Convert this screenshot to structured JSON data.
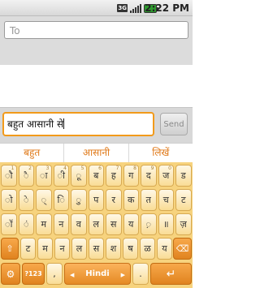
{
  "status_bar": {
    "network": "3G",
    "time": "2:22 PM"
  },
  "compose": {
    "to_placeholder": "To",
    "message_text": "बहुत आसानी से",
    "send_label": "Send"
  },
  "suggestions": [
    "बहुत",
    "आसानी",
    "लिखें"
  ],
  "keyboard": {
    "row1": [
      {
        "k": "ौ",
        "h": "1"
      },
      {
        "k": "ै",
        "h": "2"
      },
      {
        "k": "ा",
        "h": "3"
      },
      {
        "k": "ी",
        "h": "4"
      },
      {
        "k": "ू",
        "h": "5"
      },
      {
        "k": "ब",
        "h": "6"
      },
      {
        "k": "ह",
        "h": "7"
      },
      {
        "k": "ग",
        "h": "8"
      },
      {
        "k": "द",
        "h": "9"
      },
      {
        "k": "ज",
        "h": "0"
      },
      {
        "k": "ड",
        "h": ""
      }
    ],
    "row2": [
      {
        "k": "ो",
        "h": ""
      },
      {
        "k": "े",
        "h": ""
      },
      {
        "k": "्",
        "h": ""
      },
      {
        "k": "ि",
        "h": ""
      },
      {
        "k": "ु",
        "h": ""
      },
      {
        "k": "प",
        "h": ""
      },
      {
        "k": "र",
        "h": ""
      },
      {
        "k": "क",
        "h": ""
      },
      {
        "k": "त",
        "h": ""
      },
      {
        "k": "च",
        "h": ""
      },
      {
        "k": "ट",
        "h": ""
      }
    ],
    "row3": [
      {
        "k": "ॉ",
        "h": ""
      },
      {
        "k": "ं",
        "h": ""
      },
      {
        "k": "म",
        "h": ""
      },
      {
        "k": "न",
        "h": ""
      },
      {
        "k": "व",
        "h": ""
      },
      {
        "k": "ल",
        "h": ""
      },
      {
        "k": "स",
        "h": ""
      },
      {
        "k": "य",
        "h": ""
      },
      {
        "k": "़",
        "h": ""
      },
      {
        "k": "॥",
        "h": ""
      },
      {
        "k": "ज़",
        "h": ""
      }
    ],
    "row4": [
      {
        "k": "ट",
        "h": ""
      },
      {
        "k": "म",
        "h": ""
      },
      {
        "k": "न",
        "h": ""
      },
      {
        "k": "ल",
        "h": ""
      },
      {
        "k": "स",
        "h": ""
      },
      {
        "k": "श",
        "h": ""
      },
      {
        "k": "ष",
        "h": ""
      },
      {
        "k": "ळ",
        "h": ""
      },
      {
        "k": "य",
        "h": ""
      }
    ],
    "shift_label": "⇧",
    "delete_label": "⌫",
    "settings_label": "⚙",
    "symbols_label": "?123",
    "comma_label": ",",
    "space_label": "Hindi",
    "period_label": ".",
    "enter_label": "↵"
  },
  "colors": {
    "accent": "#f29a1a",
    "suggestion_text": "#e07a1a",
    "keyboard_bg": "#f7d37e"
  }
}
